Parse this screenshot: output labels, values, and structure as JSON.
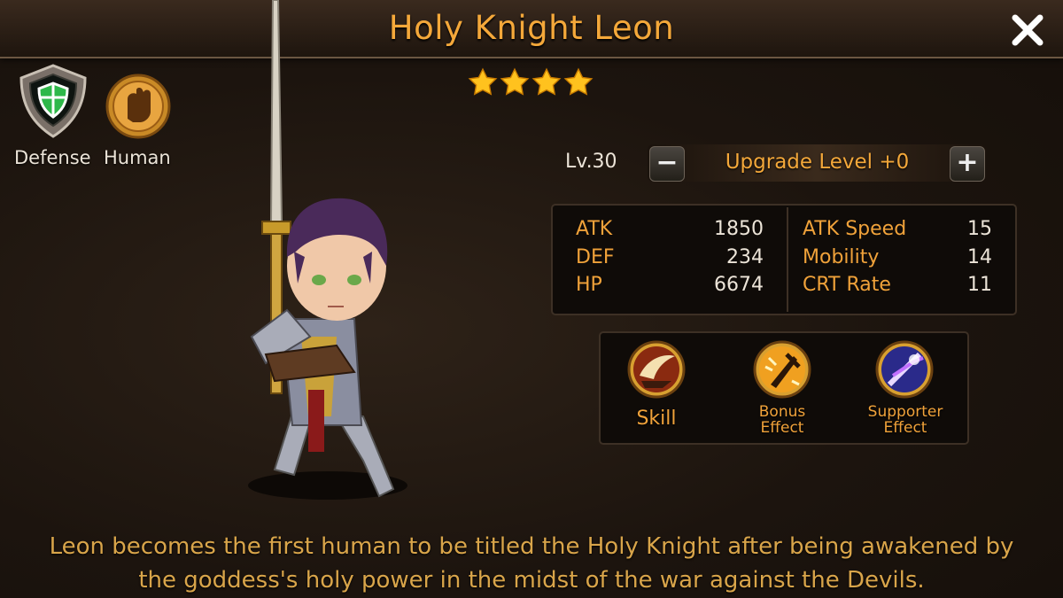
{
  "header": {
    "title": "Holy Knight Leon",
    "close_icon": "close-icon"
  },
  "rarity": {
    "stars": 4
  },
  "traits": [
    {
      "label": "Defense",
      "icon": "shield-icon"
    },
    {
      "label": "Human",
      "icon": "fist-icon"
    }
  ],
  "level": {
    "label": "Lv.30",
    "upgrade_text": "Upgrade Level +0",
    "minus": "−",
    "plus": "+"
  },
  "stats": {
    "left": [
      {
        "name": "ATK",
        "value": "1850"
      },
      {
        "name": "DEF",
        "value": "234"
      },
      {
        "name": "HP",
        "value": "6674"
      }
    ],
    "right": [
      {
        "name": "ATK Speed",
        "value": "15"
      },
      {
        "name": "Mobility",
        "value": "14"
      },
      {
        "name": "CRT Rate",
        "value": "11"
      }
    ]
  },
  "skills": [
    {
      "label": "Skill",
      "icon": "skill-slash-icon"
    },
    {
      "label_line1": "Bonus",
      "label_line2": "Effect",
      "icon": "bonus-effect-icon"
    },
    {
      "label_line1": "Supporter",
      "label_line2": "Effect",
      "icon": "supporter-effect-icon"
    }
  ],
  "description": {
    "line1": "Leon becomes the first human to be titled the Holy Knight after being awakened by",
    "line2": "the goddess's holy power in the midst of the war against the Devils."
  },
  "colors": {
    "accent": "#f4a83a",
    "text_light": "#ece4d8",
    "panel": "#0f0b08"
  }
}
